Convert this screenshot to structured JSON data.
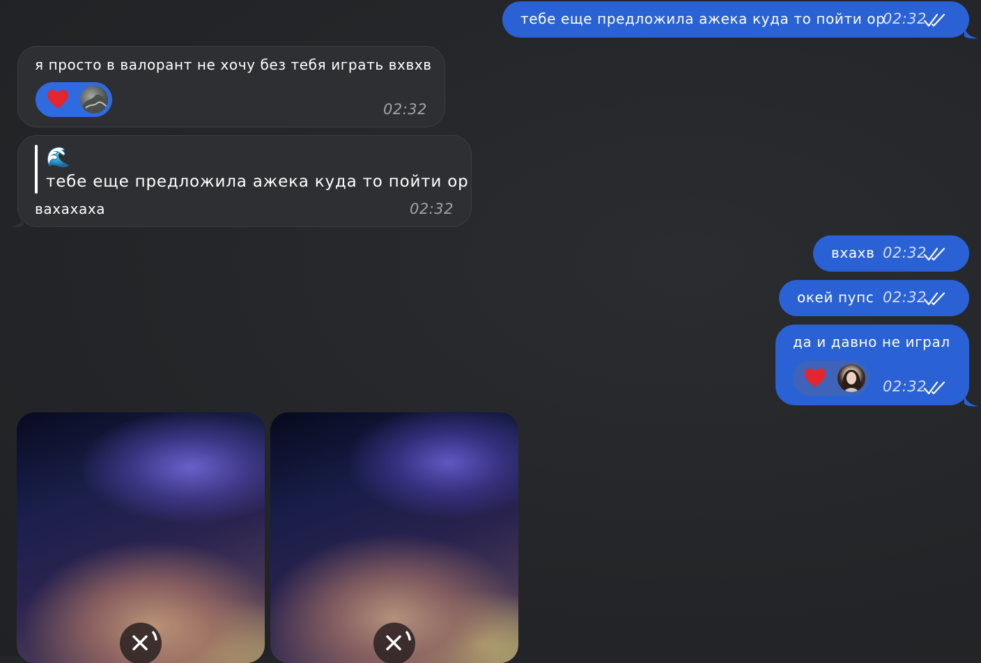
{
  "messages": [
    {
      "id": "m1",
      "direction": "outgoing",
      "text": "тебе еще предложила ажека куда то пойти ор",
      "time": "02:32",
      "status": "read"
    },
    {
      "id": "m2",
      "direction": "incoming",
      "text": "я просто в валорант не хочу без тебя играть вхвхв",
      "time": "02:32",
      "reaction": {
        "emoji": "heart",
        "by": "avatar-icon"
      }
    },
    {
      "id": "m3",
      "direction": "incoming",
      "reply_to": {
        "emoji": "🌊",
        "text": "тебе еще предложила ажека куда то пойти ор"
      },
      "text": "вахахаха",
      "time": "02:32"
    },
    {
      "id": "m4",
      "direction": "outgoing",
      "text": "вхахв",
      "time": "02:32",
      "status": "read"
    },
    {
      "id": "m5",
      "direction": "outgoing",
      "text": "окей пупс",
      "time": "02:32",
      "status": "read"
    },
    {
      "id": "m6",
      "direction": "outgoing",
      "text": "да и давно не играл",
      "time": "02:32",
      "status": "read",
      "reaction": {
        "emoji": "heart",
        "by": "avatar-icon"
      }
    }
  ],
  "media": [
    {
      "id": "photo1",
      "state": "blurred-loading",
      "close_icon": "close-icon"
    },
    {
      "id": "photo2",
      "state": "blurred-loading",
      "close_icon": "close-icon"
    }
  ],
  "colors": {
    "background": "#232528",
    "outgoing_bubble": "#2a62d6",
    "incoming_bubble": "#2d2f33",
    "heart": "#e5262e"
  }
}
